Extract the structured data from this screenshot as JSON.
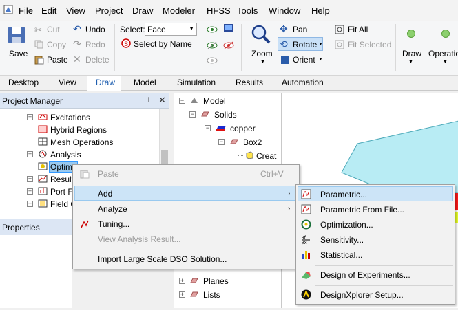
{
  "menubar": {
    "items": [
      "File",
      "Edit",
      "View",
      "Project",
      "Draw",
      "Modeler",
      "HFSS",
      "Tools",
      "Window",
      "Help"
    ]
  },
  "ribbon": {
    "save": "Save",
    "cut": "Cut",
    "copy": "Copy",
    "paste": "Paste",
    "undo": "Undo",
    "redo": "Redo",
    "delete": "Delete",
    "select_label": "Select:",
    "select_value": "Face",
    "select_by_name": "Select by Name",
    "zoom": "Zoom",
    "pan": "Pan",
    "rotate": "Rotate",
    "orient": "Orient",
    "fit_all": "Fit All",
    "fit_selected": "Fit Selected",
    "draw": "Draw",
    "operation": "Operation"
  },
  "tabs": [
    "Desktop",
    "View",
    "Draw",
    "Model",
    "Simulation",
    "Results",
    "Automation"
  ],
  "project_manager": {
    "title": "Project Manager",
    "items": [
      "Excitations",
      "Hybrid Regions",
      "Mesh Operations",
      "Analysis",
      "Optimet",
      "Result",
      "Port Fi",
      "Field C"
    ]
  },
  "properties": {
    "title": "Properties"
  },
  "model_tree": {
    "items": [
      "Model",
      "Solids",
      "copper",
      "Box2",
      "Creat",
      "Planes",
      "Lists"
    ]
  },
  "context_menu": {
    "paste": "Paste",
    "paste_shortcut": "Ctrl+V",
    "add": "Add",
    "analyze": "Analyze",
    "tuning": "Tuning...",
    "view_analysis_result": "View Analysis Result...",
    "import_dso": "Import Large Scale DSO Solution..."
  },
  "submenu": {
    "items": [
      "Parametric...",
      "Parametric From File...",
      "Optimization...",
      "Sensitivity...",
      "Statistical...",
      "Design of Experiments...",
      "DesignXplorer Setup..."
    ]
  },
  "colors": {
    "highlight": "#cce4f7",
    "panel_header": "#dce6f4",
    "model_top": "#b8ecf4",
    "model_red": "#ff1a1a"
  }
}
